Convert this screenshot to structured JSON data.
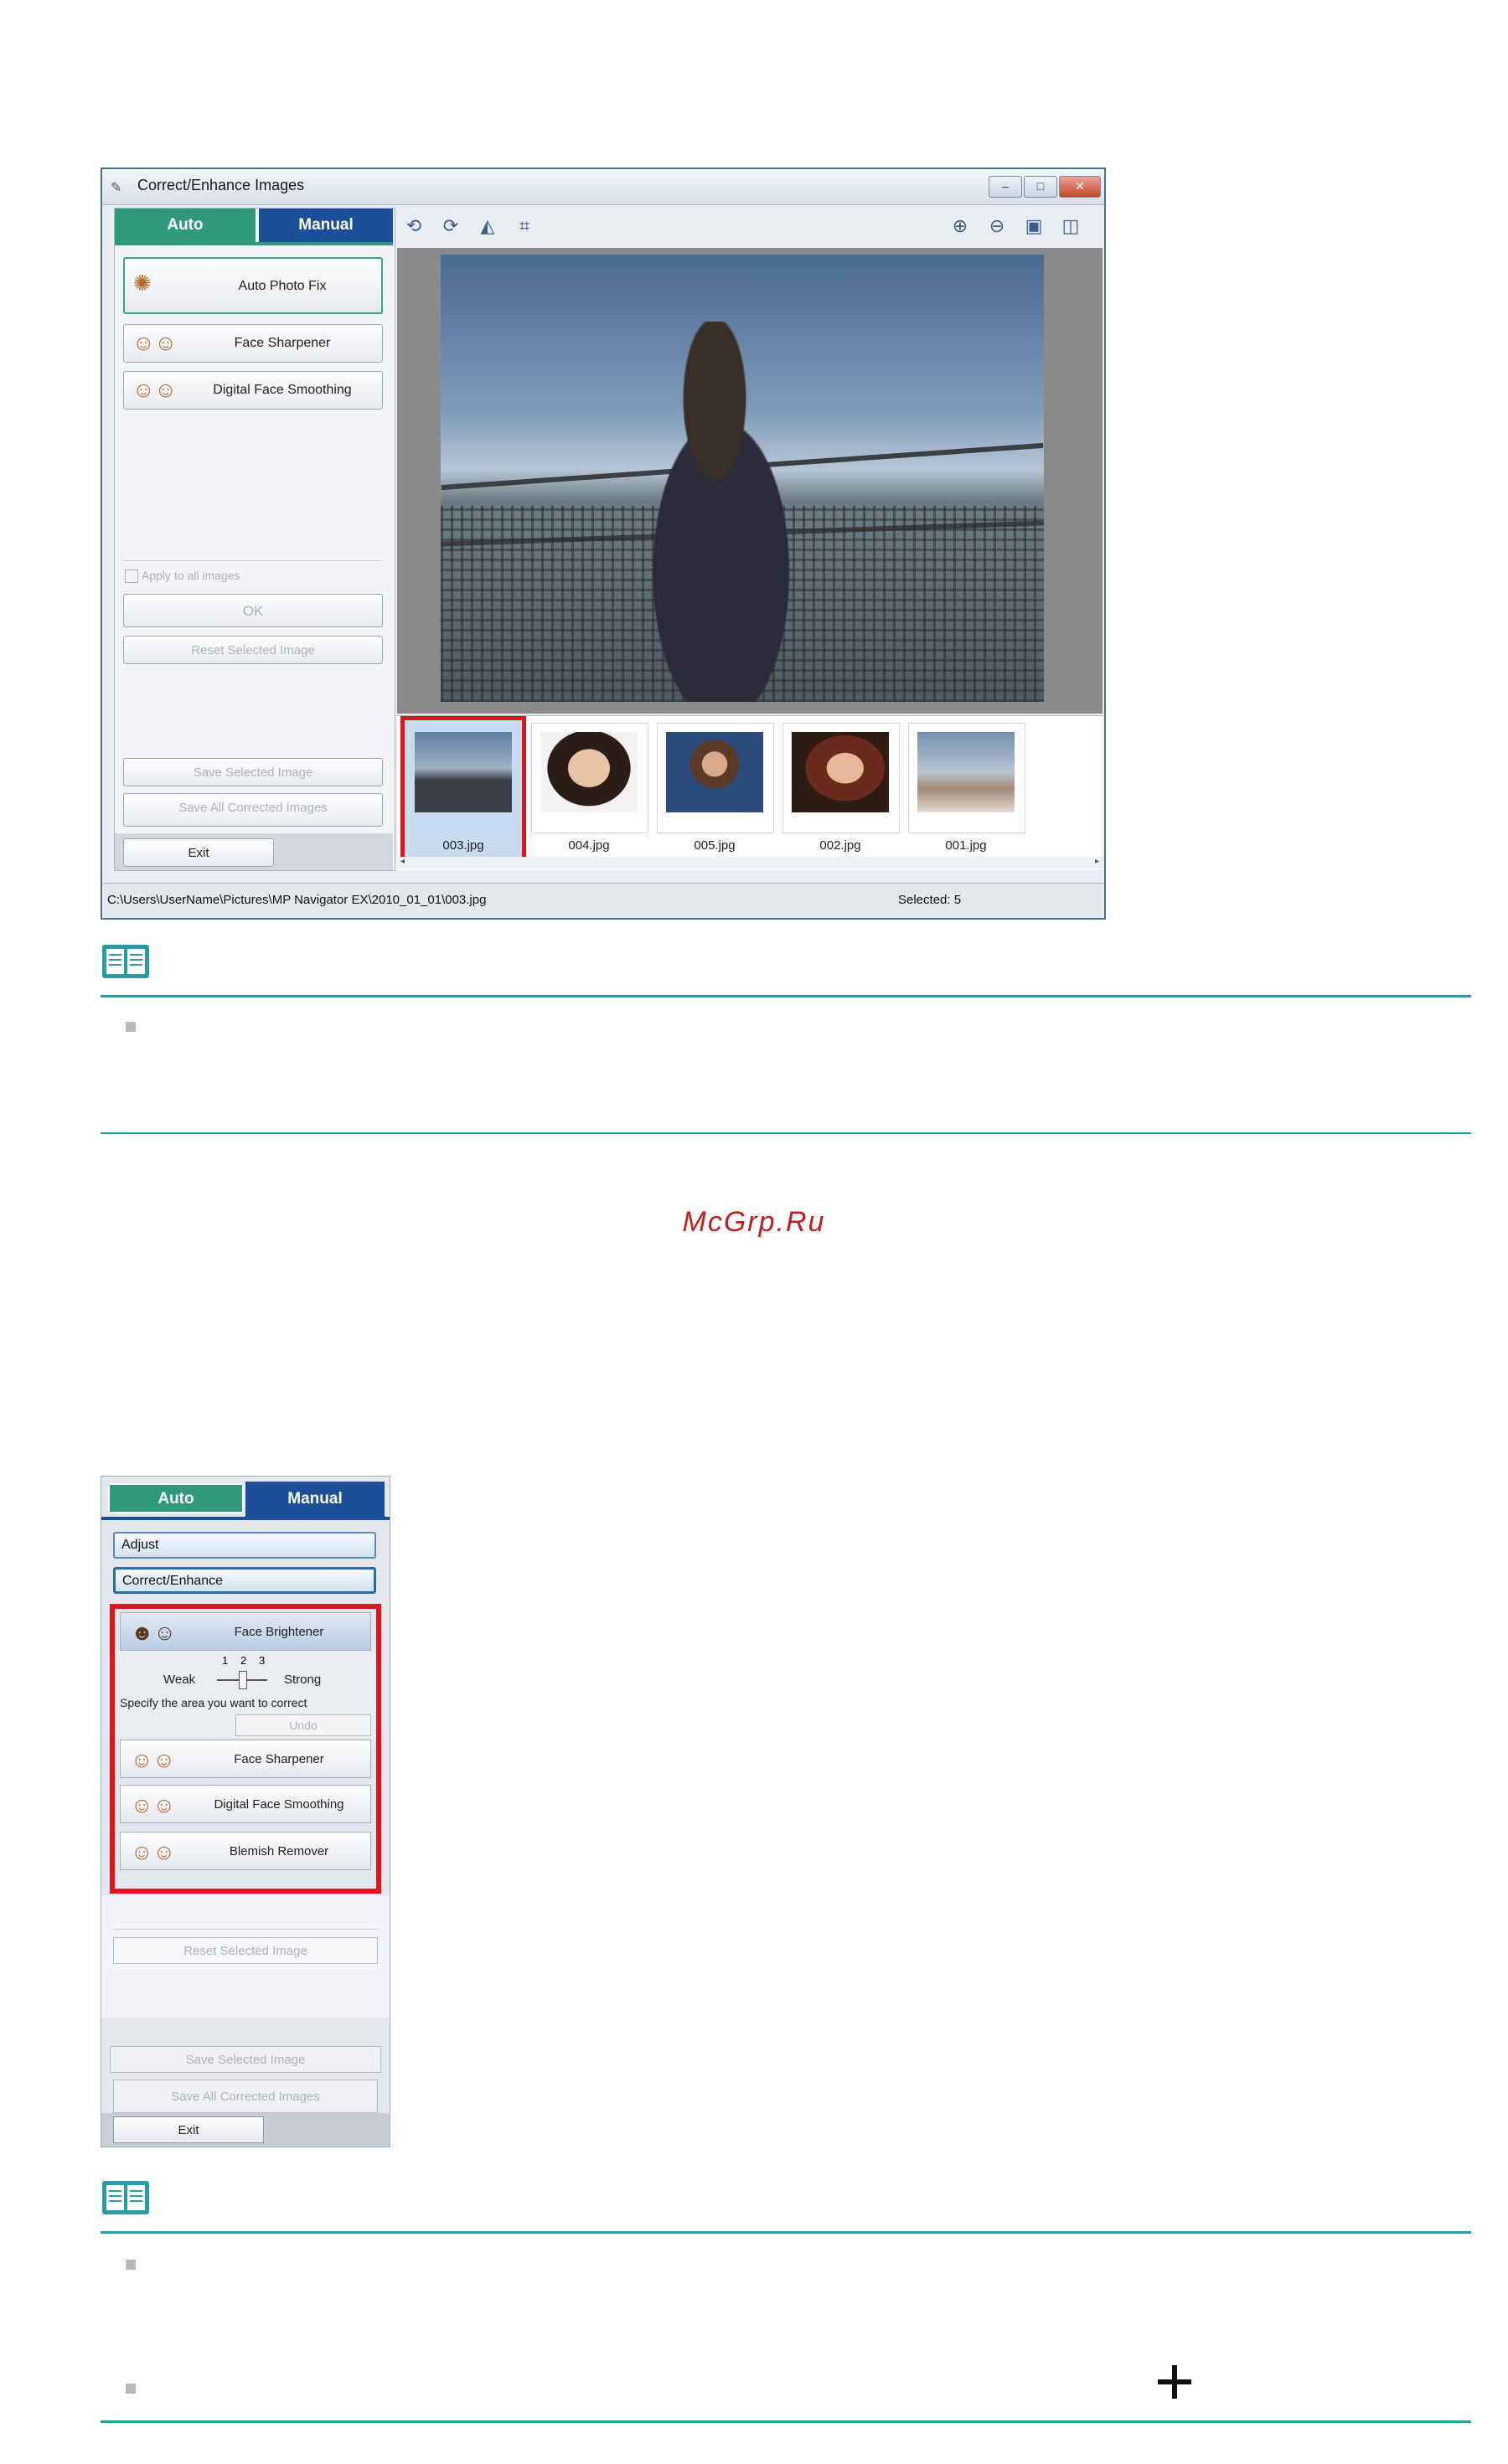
{
  "window": {
    "title": "Correct/Enhance Images",
    "caption_buttons": [
      "–",
      "□",
      "✕"
    ],
    "tabs": {
      "auto": "Auto",
      "manual": "Manual"
    },
    "auto_buttons": [
      "Auto Photo Fix",
      "Face Sharpener",
      "Digital Face Smoothing"
    ],
    "apply_all_label": "Apply to all images",
    "ok_label": "OK",
    "reset_label": "Reset Selected Image",
    "save_selected_label": "Save Selected Image",
    "save_all_label": "Save All Corrected Images",
    "exit_label": "Exit",
    "thumbnails": [
      "003.jpg",
      "004.jpg",
      "005.jpg",
      "002.jpg",
      "001.jpg"
    ],
    "selected_thumbnail": "003.jpg",
    "status_path": "C:\\Users\\UserName\\Pictures\\MP Navigator EX\\2010_01_01\\003.jpg",
    "status_selected": "Selected: 5",
    "colors": {
      "auto_tab": "#2e9a79",
      "manual_tab": "#1c4f9a",
      "highlight": "#e0141c",
      "rule": "#2a9aa3"
    }
  },
  "watermark": "McGrp.Ru",
  "panel2": {
    "tabs": {
      "auto": "Auto",
      "manual": "Manual"
    },
    "sections": [
      "Adjust",
      "Correct/Enhance"
    ],
    "face_brightener": "Face Brightener",
    "slider": {
      "weak": "Weak",
      "strong": "Strong",
      "ticks": [
        "1",
        "2",
        "3"
      ],
      "value": 2
    },
    "instruction": "Specify the area you want to correct",
    "undo_label": "Undo",
    "tools": [
      "Face Sharpener",
      "Digital Face Smoothing",
      "Blemish Remover"
    ],
    "reset_label": "Reset Selected Image",
    "save_selected_label": "Save Selected Image",
    "save_all_label": "Save All Corrected Images",
    "exit_label": "Exit"
  },
  "icons": {
    "note": "book-icon",
    "plus": "plus-icon",
    "bullet": "square-bullet-icon"
  }
}
